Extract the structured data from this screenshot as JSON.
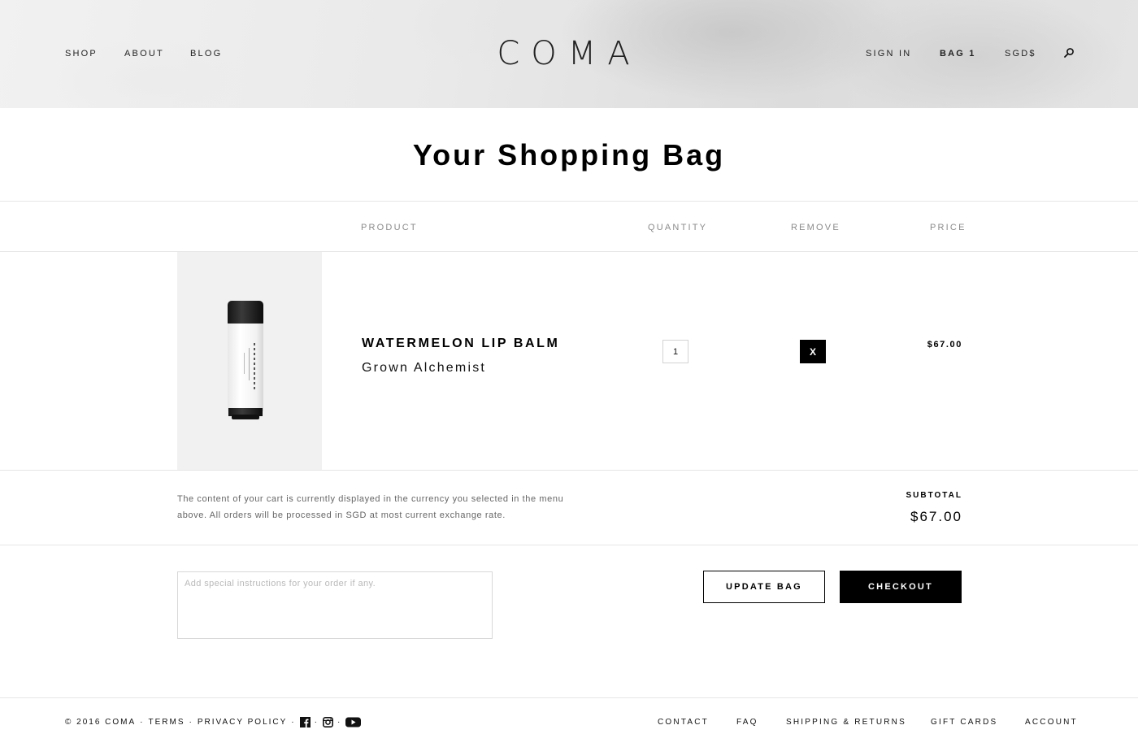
{
  "header": {
    "logo": "COMA",
    "nav_left": [
      "SHOP",
      "ABOUT",
      "BLOG"
    ],
    "sign_in": "SIGN IN",
    "bag": "BAG 1",
    "currency": "SGD$",
    "search_icon": "search-icon"
  },
  "page": {
    "title": "Your Shopping Bag"
  },
  "table": {
    "headers": {
      "product": "PRODUCT",
      "quantity": "QUANTITY",
      "remove": "REMOVE",
      "price": "PRICE"
    },
    "rows": [
      {
        "name": "WATERMELON LIP BALM",
        "brand": "Grown Alchemist",
        "quantity": "1",
        "remove_label": "X",
        "price": "$67.00",
        "image_label": "lip-balm-tube"
      }
    ]
  },
  "summary": {
    "currency_note": "The content of your cart is currently displayed in the currency you selected in the menu above. All orders will be processed in SGD at most current exchange rate.",
    "subtotal_label": "SUBTOTAL",
    "subtotal_value": "$67.00"
  },
  "actions": {
    "instructions_placeholder": "Add special instructions for your order if any.",
    "update_label": "UPDATE BAG",
    "checkout_label": "CHECKOUT"
  },
  "footer": {
    "copyright": "© 2016 COMA",
    "terms": "TERMS",
    "privacy": "PRIVACY POLICY",
    "separator": "·",
    "social_icons": [
      "facebook-icon",
      "instagram-icon",
      "youtube-icon"
    ],
    "links": [
      "CONTACT",
      "FAQ",
      "SHIPPING & RETURNS",
      "GIFT CARDS",
      "ACCOUNT"
    ]
  },
  "colors": {
    "text": "#111111",
    "accent": "#000000",
    "muted": "#8a8a8a",
    "divider": "#e6e6e6",
    "image_bg": "#f1f1f1"
  }
}
